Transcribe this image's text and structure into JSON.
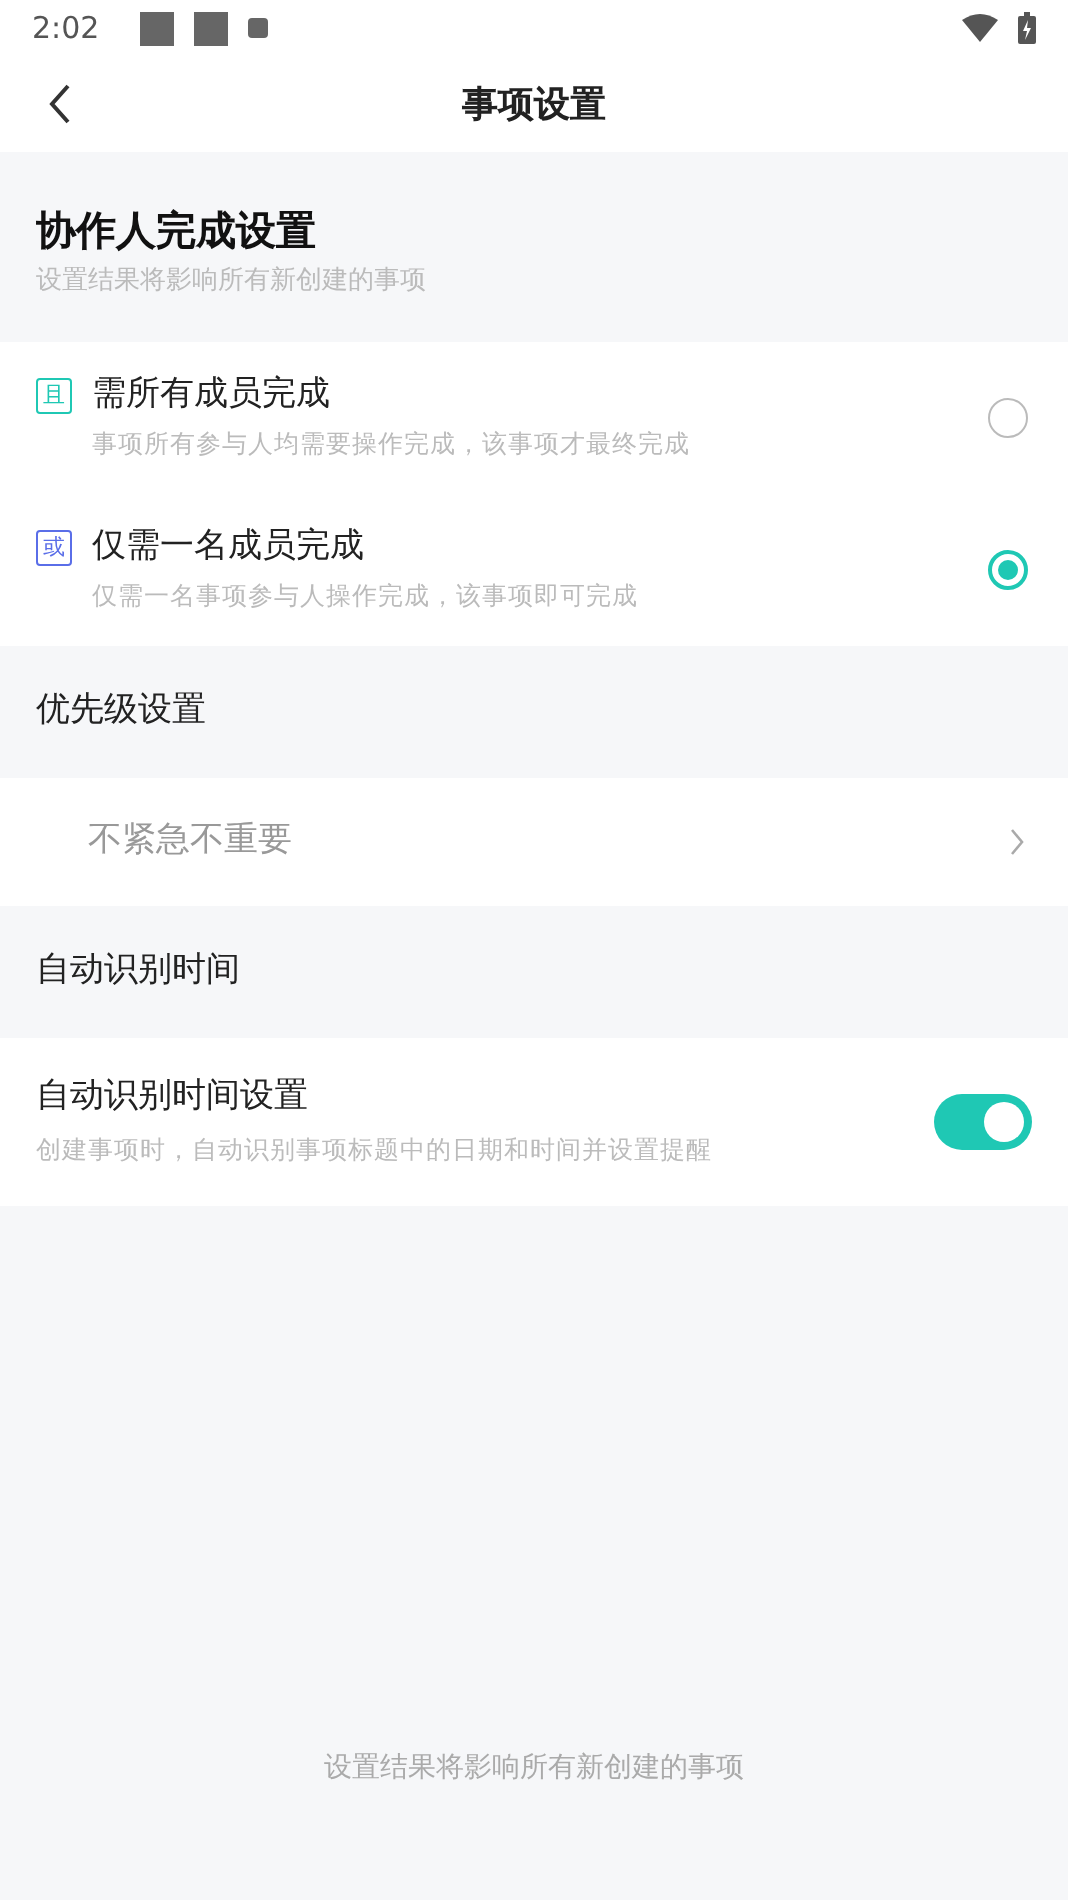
{
  "status_bar": {
    "time": "2:02"
  },
  "header": {
    "title": "事项设置"
  },
  "collaborator_section": {
    "title": "协作人完成设置",
    "subtitle": "设置结果将影响所有新创建的事项",
    "options": [
      {
        "badge": "且",
        "color": "#1fc8b4",
        "title": "需所有成员完成",
        "description": "事项所有参与人均需要操作完成，该事项才最终完成",
        "selected": false
      },
      {
        "badge": "或",
        "color": "#5a6ee8",
        "title": "仅需一名成员完成",
        "description": "仅需一名事项参与人操作完成，该事项即可完成",
        "selected": true
      }
    ]
  },
  "priority_section": {
    "title": "优先级设置",
    "value": "不紧急不重要"
  },
  "auto_time_section": {
    "title": "自动识别时间",
    "setting": {
      "title": "自动识别时间设置",
      "description": "创建事项时，自动识别事项标题中的日期和时间并设置提醒",
      "on": true
    }
  },
  "footer_note": "设置结果将影响所有新创建的事项"
}
